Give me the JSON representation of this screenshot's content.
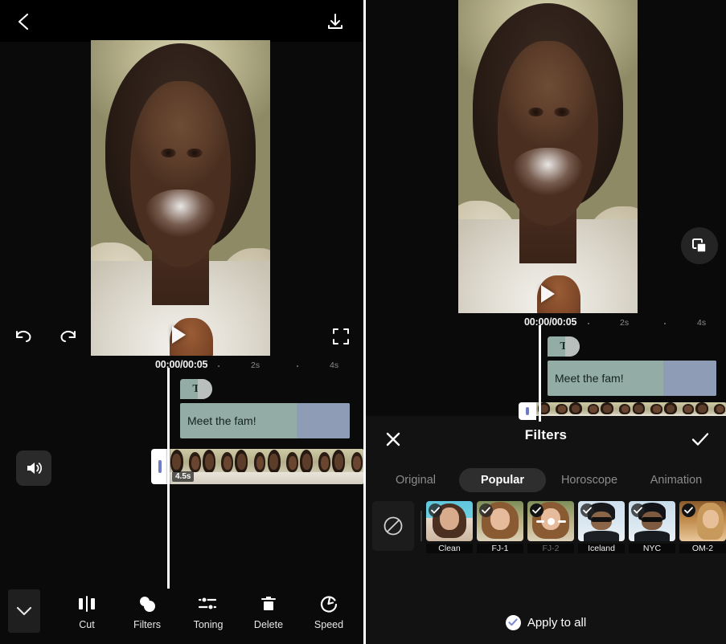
{
  "colors": {
    "background": "#000000",
    "panel_bg": "#0a0a0a",
    "sheet_bg": "#121212",
    "text_clip": "#93ada6",
    "text_clip_tail": "#8e9cb5",
    "playhead": "#ffffff",
    "active_tab_pill": "#2e2e2e",
    "apply_check": "#7b86d6",
    "handle_bar": "#6f7dc4"
  },
  "left_panel": {
    "topbar": {
      "back_icon": "chevron-left-icon",
      "export_icon": "download-icon"
    },
    "preview": {
      "play_icon": "play-icon"
    },
    "controls": {
      "undo_icon": "undo-icon",
      "redo_icon": "redo-icon",
      "fullscreen_icon": "fullscreen-icon"
    },
    "ruler": {
      "current_time": "00:00/00:05",
      "ticks": [
        "2s",
        "4s"
      ]
    },
    "timeline": {
      "text_badge_label": "T",
      "text_clip_label": "Meet the fam!",
      "video_clip_duration": "4.5s",
      "volume_icon": "volume-icon"
    },
    "toolbar": {
      "collapse_icon": "chevron-down-icon",
      "items": [
        {
          "label": "Cut",
          "icon": "cut-icon"
        },
        {
          "label": "Filters",
          "icon": "filters-icon"
        },
        {
          "label": "Toning",
          "icon": "toning-icon"
        },
        {
          "label": "Delete",
          "icon": "trash-icon"
        },
        {
          "label": "Speed",
          "icon": "speed-icon"
        }
      ]
    }
  },
  "right_panel": {
    "preview": {
      "play_icon": "play-icon",
      "duplicate_icon": "duplicate-icon"
    },
    "ruler": {
      "current_time": "00:00/00:05",
      "ticks": [
        "2s",
        "4s"
      ]
    },
    "timeline": {
      "text_badge_label": "T",
      "text_clip_label": "Meet the fam!"
    },
    "filters_sheet": {
      "close_icon": "close-icon",
      "title": "Filters",
      "confirm_icon": "check-icon",
      "tabs": [
        {
          "label": "Original",
          "active": false
        },
        {
          "label": "Popular",
          "active": true
        },
        {
          "label": "Horoscope",
          "active": false
        },
        {
          "label": "Animation",
          "active": false
        }
      ],
      "none_icon": "no-filter-icon",
      "filters": [
        {
          "label": "Clean",
          "selected": true,
          "downloading": false
        },
        {
          "label": "FJ-1",
          "selected": true,
          "downloading": false
        },
        {
          "label": "FJ-2",
          "selected": true,
          "downloading": true
        },
        {
          "label": "Iceland",
          "selected": true,
          "downloading": false
        },
        {
          "label": "NYC",
          "selected": true,
          "downloading": false
        },
        {
          "label": "OM-2",
          "selected": true,
          "downloading": false
        }
      ],
      "apply_to_all_label": "Apply to all",
      "apply_to_all_icon": "check-circle-icon"
    }
  }
}
